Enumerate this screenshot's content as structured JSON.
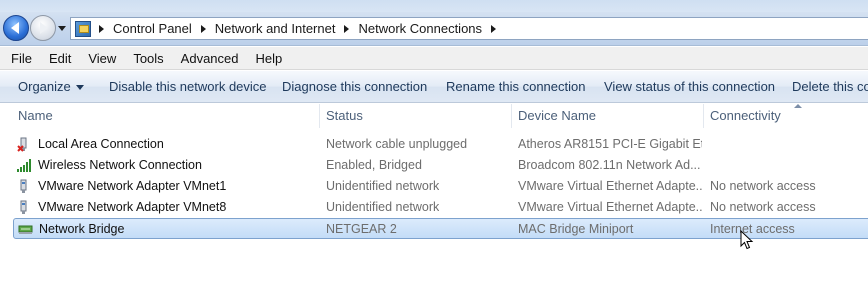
{
  "breadcrumb": {
    "items": [
      "Control Panel",
      "Network and Internet",
      "Network Connections"
    ]
  },
  "menu": {
    "items": [
      "File",
      "Edit",
      "View",
      "Tools",
      "Advanced",
      "Help"
    ]
  },
  "toolbar": {
    "organize": "Organize",
    "disable": "Disable this network device",
    "diagnose": "Diagnose this connection",
    "rename": "Rename this connection",
    "view_status": "View status of this connection",
    "delete": "Delete this co"
  },
  "columns": {
    "name": "Name",
    "status": "Status",
    "device": "Device Name",
    "connectivity": "Connectivity"
  },
  "rows": [
    {
      "name": "Local Area Connection",
      "status": "Network cable unplugged",
      "device": "Atheros AR8151 PCI-E Gigabit Et...",
      "connectivity": "",
      "icon": "ethernet-unplugged-icon"
    },
    {
      "name": "Wireless Network Connection",
      "status": "Enabled, Bridged",
      "device": "Broadcom 802.11n Network Ad...",
      "connectivity": "",
      "icon": "wireless-signal-icon"
    },
    {
      "name": "VMware Network Adapter VMnet1",
      "status": "Unidentified network",
      "device": "VMware Virtual Ethernet Adapte...",
      "connectivity": "No network access",
      "icon": "network-adapter-icon"
    },
    {
      "name": "VMware Network Adapter VMnet8",
      "status": "Unidentified network",
      "device": "VMware Virtual Ethernet Adapte...",
      "connectivity": "No network access",
      "icon": "network-adapter-icon"
    },
    {
      "name": "Network Bridge",
      "status": "NETGEAR  2",
      "device": "MAC Bridge Miniport",
      "connectivity": "Internet access",
      "icon": "network-bridge-icon"
    }
  ],
  "colors": {
    "command_text": "#1e395b",
    "selection_border": "#7da2ce",
    "column_header": "#4c607a"
  }
}
